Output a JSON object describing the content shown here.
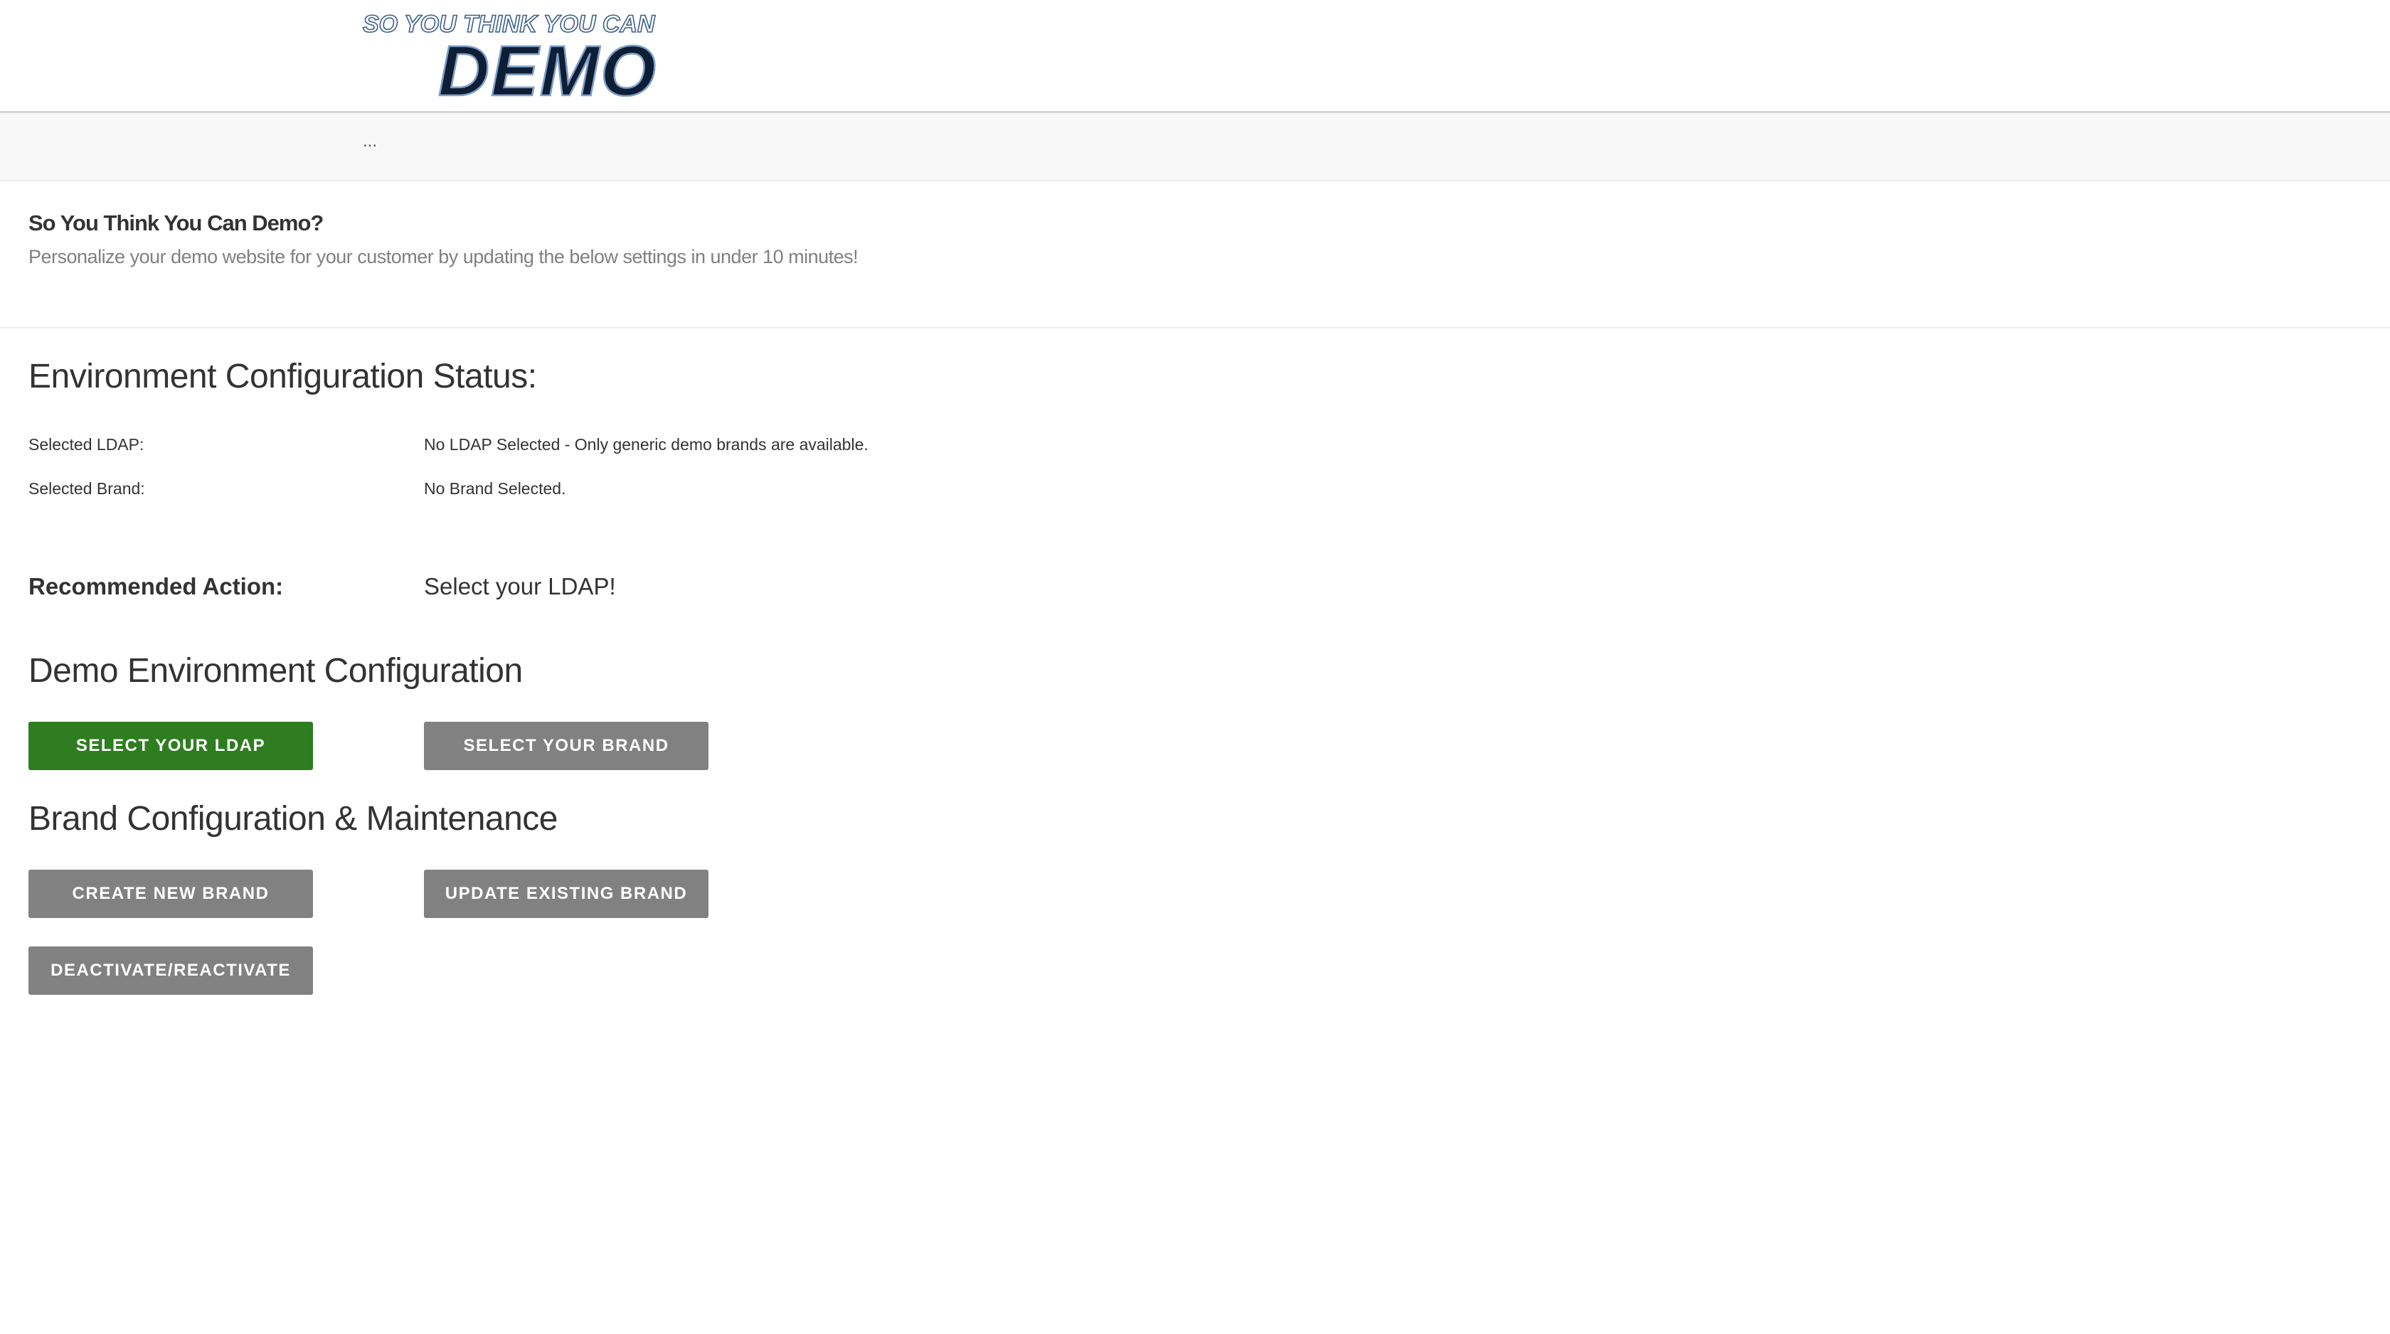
{
  "header": {
    "logo": {
      "line1": "SO YOU THINK YOU CAN",
      "line2": "DEMO"
    }
  },
  "breadcrumb": {
    "text": "..."
  },
  "intro": {
    "title": "So You Think You Can Demo?",
    "subtitle": "Personalize your demo website for your customer by updating the below settings in under 10 minutes!"
  },
  "status": {
    "heading": "Environment Configuration Status:",
    "ldap_label": "Selected LDAP:",
    "ldap_value": "No LDAP Selected - Only generic demo brands are available.",
    "brand_label": "Selected Brand:",
    "brand_value": "No Brand Selected.",
    "action_label": "Recommended Action:",
    "action_value": "Select your LDAP!"
  },
  "demo_config": {
    "heading": "Demo Environment Configuration",
    "select_ldap_label": "SELECT YOUR LDAP",
    "select_brand_label": "SELECT YOUR BRAND"
  },
  "brand_maintenance": {
    "heading": "Brand Configuration & Maintenance",
    "create_label": "CREATE NEW BRAND",
    "update_label": "UPDATE EXISTING BRAND",
    "deactivate_label": "DEACTIVATE/REACTIVATE"
  },
  "colors": {
    "primary_button": "#2e7d20",
    "secondary_button": "#818181",
    "logo_dark": "#0e1e35",
    "logo_light": "#3c5f8c"
  }
}
